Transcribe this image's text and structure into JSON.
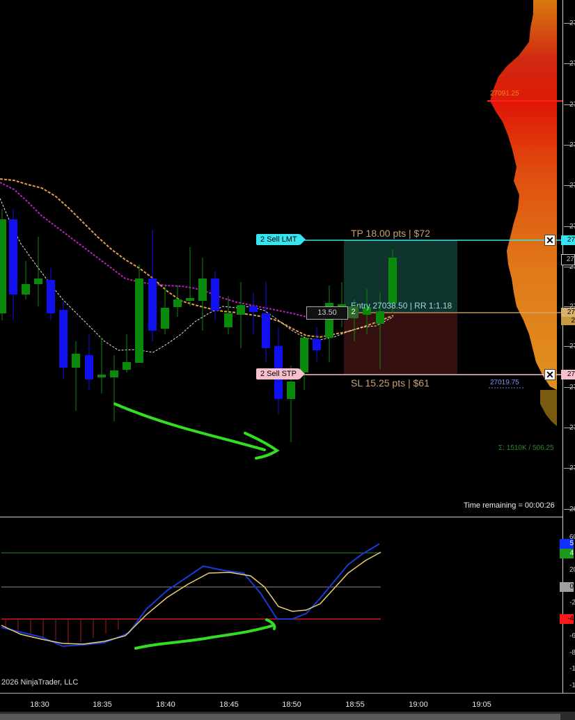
{
  "copyright": "2026 NinjaTrader, LLC",
  "time_remaining": "Time remaining = 00:00:26",
  "time_axis": [
    "18:30",
    "18:35",
    "18:40",
    "18:45",
    "18:50",
    "18:55",
    "19:00",
    "19:05"
  ],
  "price_axis_ticks": [
    "27",
    "27",
    "27",
    "27",
    "27",
    "27",
    "27",
    "27",
    "27",
    "27",
    "27",
    "27",
    "26"
  ],
  "volume_profile": {
    "poc_label": "27091.25",
    "low_label": "27019.75",
    "summary": "Σ: 1510K / 506.25"
  },
  "trade": {
    "tp_label": "TP 18.00 pts | $72",
    "sl_label": "SL 15.25 pts | $61",
    "entry_label": "Entry 27038.50 | RR 1:1.18",
    "entry_box": "13.50",
    "entry_qty": "2",
    "tp_order": "2  Sell LMT",
    "sl_order": "2  Sell STP",
    "close_symbol": "✕",
    "tp_marker": "27",
    "sl_marker": "27",
    "entry_marker": "27",
    "entry_marker2": "2",
    "last_price_marker": "27"
  },
  "oscillator": {
    "axis_ticks": [
      "60",
      "20",
      "-2",
      "-6",
      "-8",
      "-1",
      "-1"
    ],
    "markers": [
      {
        "label": "5",
        "color": "#1030ff"
      },
      {
        "label": "4",
        "color": "#1a9a1a"
      },
      {
        "label": "0",
        "color": "#a0a0a0"
      },
      {
        "label": "-4",
        "color": "#ff1a1a"
      }
    ]
  },
  "colors": {
    "bull": "#0a8a0a",
    "bear": "#1010f0",
    "tp_line": "#36e5f0",
    "sl_line": "#f8c0cc",
    "entry_line": "#d8b070",
    "annotation": "#33dd22"
  }
}
